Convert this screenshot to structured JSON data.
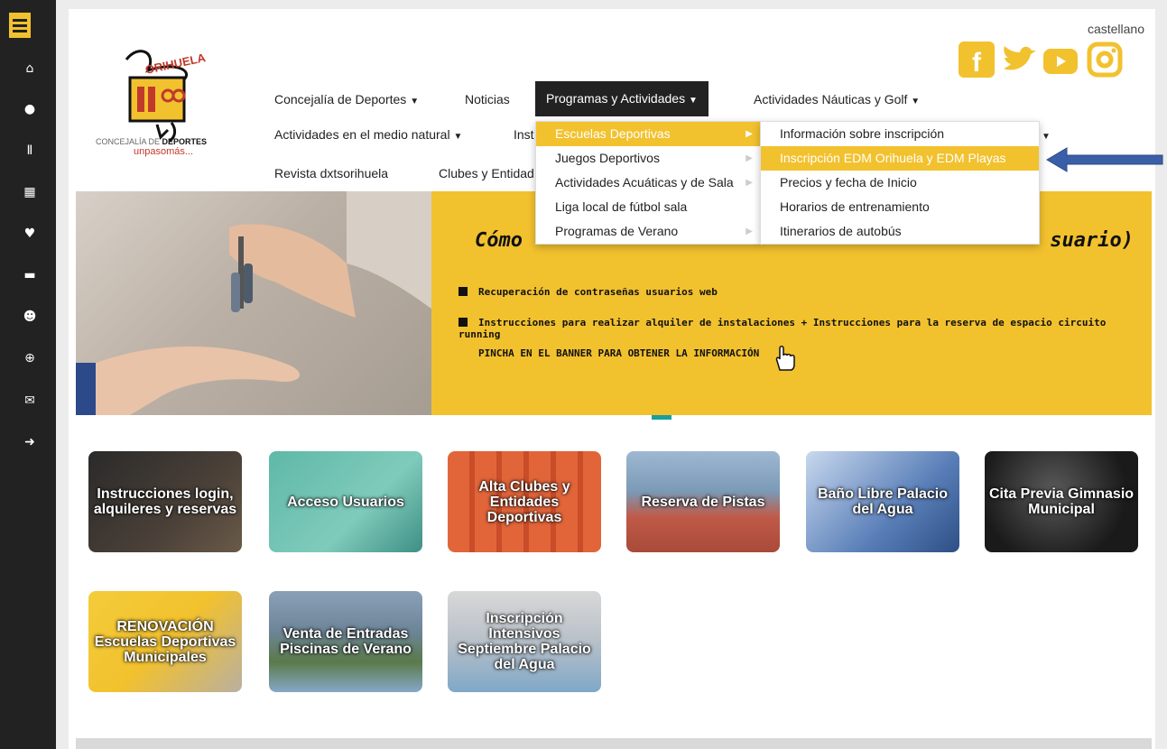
{
  "sidebar": {
    "icons": [
      "menu-icon",
      "home-icon",
      "user-icon",
      "dumbbell-icon",
      "calendar-icon",
      "heart-icon",
      "ticket-icon",
      "users-icon",
      "search-icon",
      "envelope-icon",
      "logout-icon"
    ]
  },
  "header": {
    "language": "castellano",
    "social": [
      "facebook",
      "twitter",
      "youtube",
      "instagram"
    ],
    "logo": {
      "top": "ORIHUELA",
      "line1_a": "CONCEJALÍA DE ",
      "line1_b": "DEPORTES",
      "line2": "unpasomás..."
    }
  },
  "nav": {
    "row1": [
      "Concejalía de Deportes",
      "Noticias",
      "Programas y Actividades",
      "Actividades Náuticas y Golf"
    ],
    "row2": [
      "Actividades en el medio natural",
      "Inst"
    ],
    "row3": [
      "Revista dxtsorihuela",
      "Clubes y Entidad"
    ]
  },
  "dropdown": {
    "items": [
      "Escuelas Deportivas",
      "Juegos Deportivos",
      "Actividades Acuáticas y de Sala",
      "Liga local de fútbol sala",
      "Programas de Verano"
    ]
  },
  "submenu": {
    "items": [
      "Información sobre inscripción",
      "Inscripción EDM Orihuela y EDM Playas",
      "Precios y fecha de Inicio",
      "Horarios de entrenamiento",
      "Itinerarios de autobús"
    ]
  },
  "banner": {
    "title_left": "Cómo",
    "title_right": "suario)",
    "bullet1": "Recuperación de contraseñas usuarios web",
    "bullet2": "Instrucciones para realizar alquiler de instalaciones + Instrucciones para la reserva de espacio circuito running",
    "cta": "PINCHA EN EL BANNER PARA OBTENER LA INFORMACIÓN",
    "slides": 5,
    "active_slide": 5
  },
  "tiles": [
    {
      "label": "Instrucciones login, alquileres y reservas"
    },
    {
      "label": "Acceso Usuarios"
    },
    {
      "label": "Alta Clubes y Entidades Deportivas"
    },
    {
      "label": "Reserva de Pistas"
    },
    {
      "label": "Baño Libre Palacio del Agua"
    },
    {
      "label": "Cita Previa Gimnasio Municipal"
    },
    {
      "label": "RENOVACIÓN Escuelas Deportivas Municipales"
    },
    {
      "label": "Venta de Entradas Piscinas de Verano"
    },
    {
      "label": "Inscripción Intensivos Septiembre Palacio del Agua"
    }
  ],
  "colors": {
    "accent": "#f2c12e",
    "sidebar": "#222222",
    "arrow": "#3a5fa8",
    "active_dot": "#1a9f9a"
  }
}
